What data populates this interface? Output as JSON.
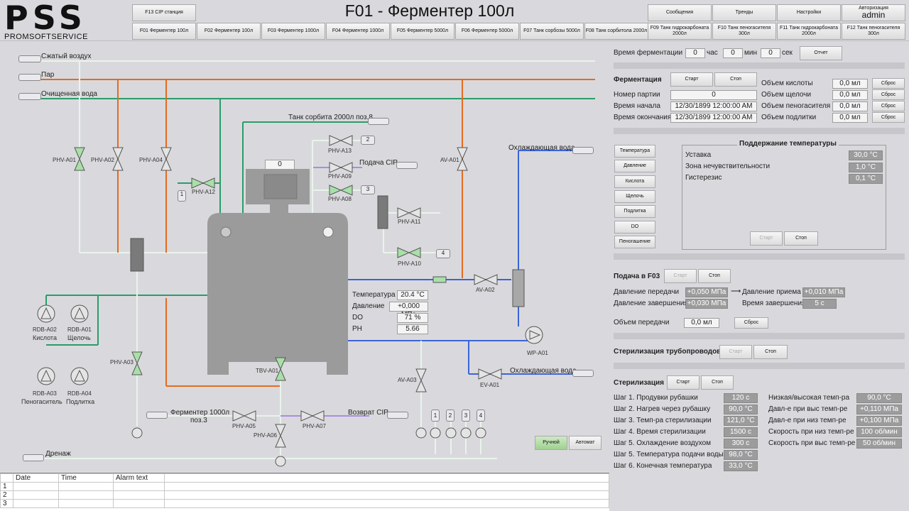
{
  "header": {
    "logo_big": "PSS",
    "logo_small": "PROMSOFTSERVICE",
    "title": "F01 - Ферментер 100л",
    "cip_station": "F13 CIP станция",
    "tabs": [
      "F01 Ферментер 100л",
      "F02 Ферментер 100л",
      "F03 Ферментер 1000л",
      "F04 Ферментер 1000л",
      "F05 Ферментер 5000л",
      "F06 Ферментер 5000л",
      "F07 Танк сорбозы 5000л",
      "F08 Танк сорбитола 2000л",
      "F09 Танк гидрокарбоната 2000л",
      "F10 Танк пеногасителя 300л",
      "F11 Танк гидрокарбоната 2000л",
      "F12 Танк пеногасителя 300л"
    ],
    "messages": "Сообщения",
    "trends": "Тренды",
    "settings": "Настройки",
    "auth_label": "Авторизация",
    "user": "admin"
  },
  "diagram": {
    "compressed_air": "Сжатый воздух",
    "steam": "Пар",
    "clean_water": "Очищенная вода",
    "sorbitol_tank": "Танк сорбита 2000л поз.8",
    "cip_supply": "Подача CIP",
    "cooling_water_top": "Охлаждающая вода",
    "cooling_water_bottom": "Охлаждающая вода",
    "fermenter_1000": "Ферментер 1000л",
    "pos3": "поз.3",
    "cip_return": "Возврат CIP",
    "drain": "Дренаж",
    "tank_counter": "0",
    "valves": {
      "a01": "PHV-A01",
      "a02": "PHV-A02",
      "a04": "PHV-A04",
      "a12": "PHV-A12",
      "a13": "PHV-A13",
      "a09": "PHV-A09",
      "a08": "PHV-A08",
      "a11": "PHV-A11",
      "a10": "PHV-A10",
      "av_a01": "AV-A01",
      "av_a02": "AV-A02",
      "a03": "PHV-A03",
      "tbv": "TBV-A01",
      "av_a03": "AV-A03",
      "ev": "EV-A01",
      "a05": "PHV-A05",
      "a06": "PHV-A06",
      "a07": "PHV-A07",
      "wp": "WP-A01"
    },
    "num_1": "1",
    "num_2": "2",
    "num_3": "3",
    "num_4": "4",
    "pumps": {
      "rdb_a02": "RDB-A02",
      "acid": "Кислота",
      "rdb_a01": "RDB-A01",
      "alkali": "Щелочь",
      "rdb_a03": "RDB-A03",
      "antifoam": "Пеногаситель",
      "rdb_a04": "RDB-A04",
      "feed": "Подлитка"
    },
    "readings": {
      "temp_label": "Температура",
      "temp": "20.4 °C",
      "pressure_label": "Давление",
      "pressure": "+0,000 МПа",
      "do_label": "DO",
      "do": "71 %",
      "ph_label": "PH",
      "ph": "5.66"
    },
    "ports": [
      "1",
      "2",
      "3",
      "4"
    ],
    "manual": "Ручной",
    "auto": "Автомат"
  },
  "right": {
    "ferm_time_label": "Время ферментации",
    "hours": "0",
    "hours_unit": "час",
    "minutes": "0",
    "minutes_unit": "мин",
    "seconds": "0",
    "seconds_unit": "сек",
    "report": "Отчет",
    "fermentation": "Ферментация",
    "start": "Старт",
    "stop": "Стоп",
    "batch_label": "Номер партии",
    "batch": "0",
    "start_time_label": "Время начала",
    "start_time": "12/30/1899 12:00:00 AM",
    "end_time_label": "Время окончания",
    "end_time": "12/30/1899 12:00:00 AM",
    "acid_vol_label": "Объем кислоты",
    "acid_vol": "0,0 мл",
    "alkali_vol_label": "Объем щелочи",
    "alkali_vol": "0,0 мл",
    "antifoam_vol_label": "Объем пеногасителя",
    "antifoam_vol": "0,0 мл",
    "feed_vol_label": "Объем подлитки",
    "feed_vol": "0,0 мл",
    "reset": "Сброс",
    "side_buttons": [
      "Температура",
      "Давление",
      "Кислота",
      "Щелочь",
      "Подлитка",
      "DO",
      "Пеногашение"
    ],
    "temp_box_title": "Поддержание температуры",
    "setpoint_label": "Уставка",
    "setpoint": "30,0 °C",
    "deadband_label": "Зона нечувствительности",
    "deadband": "1,0 °C",
    "hysteresis_label": "Гистерезис",
    "hysteresis": "0,1 °C",
    "transfer_title": "Подача в F03",
    "send_pressure_label": "Давление передачи",
    "send_pressure": "+0,050 МПа",
    "recv_pressure_label": "Давление приема",
    "recv_pressure": "+0,010 МПа",
    "end_pressure_label": "Давление завершения",
    "end_pressure": "+0,030 МПа",
    "end_time2_label": "Время завершения",
    "end_time2": "5 с",
    "transfer_vol_label": "Объем передачи",
    "transfer_vol": "0,0 мл",
    "pipe_steril_title": "Стерилизация трубопроводов",
    "steril_title": "Стерилизация",
    "steps": [
      {
        "label": "Шаг 1. Продувки рубашки",
        "value": "120 с"
      },
      {
        "label": "Шаг 2. Нагрев через рубашку",
        "value": "90,0 °C"
      },
      {
        "label": "Шаг 3. Темп-ра стерилизации",
        "value": "121,0 °C"
      },
      {
        "label": "Шаг 4. Время стерилизации",
        "value": "1500 с"
      },
      {
        "label": "Шаг 5. Охлаждение воздухом",
        "value": "300 с"
      },
      {
        "label": "Шаг 5. Температура подачи воды",
        "value": "98,0 °C"
      },
      {
        "label": "Шаг 6. Конечная температура",
        "value": "33,0 °C"
      }
    ],
    "params": [
      {
        "label": "Низкая/высокая темп-ра",
        "value": "90,0 °C"
      },
      {
        "label": "Давл-е при выс темп-ре",
        "value": "+0,110 МПа"
      },
      {
        "label": "Давл-е при низ темп-ре",
        "value": "+0,100 МПа"
      },
      {
        "label": "Скорость при низ темп-ре",
        "value": "100 об/мин"
      },
      {
        "label": "Скорость при выс темп-ре",
        "value": "50 об/мин"
      }
    ]
  },
  "alarms": {
    "headers": [
      "Date",
      "Time",
      "Alarm text"
    ],
    "rows": [
      "1",
      "2",
      "3"
    ]
  }
}
